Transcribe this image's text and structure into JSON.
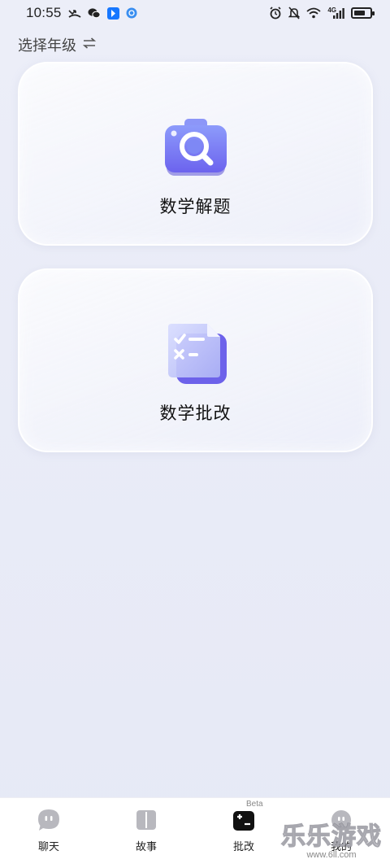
{
  "status_bar": {
    "time": "10:55",
    "network": "4G",
    "battery_level": 0.7
  },
  "grade_selector": {
    "label": "选择年级",
    "icon": "swap-arrows-icon"
  },
  "cards": [
    {
      "label": "数学解题",
      "icon": "camera-search-icon"
    },
    {
      "label": "数学批改",
      "icon": "grading-sheet-icon"
    }
  ],
  "bottom_nav": {
    "items": [
      {
        "label": "聊天",
        "icon": "chat-bubble-icon",
        "active": false
      },
      {
        "label": "故事",
        "icon": "book-icon",
        "active": false
      },
      {
        "label": "批改",
        "icon": "plus-minus-icon",
        "active": true,
        "badge": "Beta"
      },
      {
        "label": "我的",
        "icon": "profile-icon",
        "active": false
      }
    ]
  },
  "watermark": {
    "main": "乐乐游戏",
    "sub": "www.6ll.com"
  },
  "colors": {
    "background": "#E8EAF6",
    "accent_purple": "#7C72F2",
    "nav_inactive": "#B8B8BE",
    "nav_active": "#111111"
  }
}
